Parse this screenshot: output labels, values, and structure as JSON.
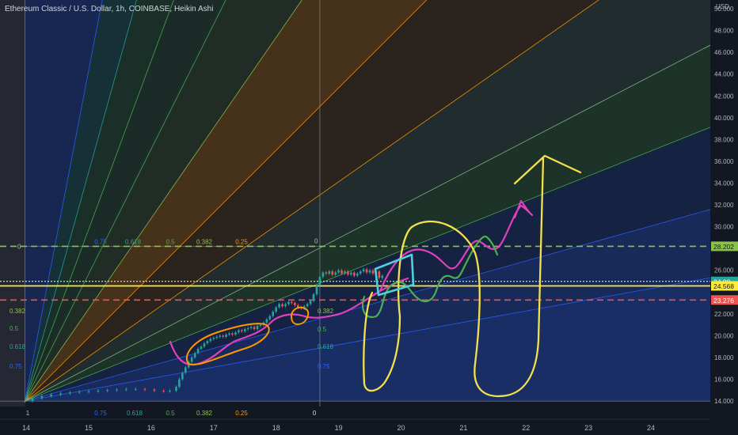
{
  "header": {
    "title": "Ethereum Classic / U.S. Dollar, 1h, COINBASE, Heikin Ashi"
  },
  "chart_data": {
    "type": "candlestick",
    "currency_label": "USD",
    "y_ticks": [
      14,
      16,
      18,
      20,
      22,
      24,
      26,
      28,
      30,
      32,
      34,
      36,
      38,
      40,
      42,
      44,
      46,
      48,
      50
    ],
    "y_tick_labels": [
      "14.000",
      "16.000",
      "18.000",
      "20.000",
      "22.000",
      "",
      "26.000",
      "",
      "30.000",
      "32.000",
      "34.000",
      "36.000",
      "38.000",
      "40.000",
      "42.000",
      "44.000",
      "46.000",
      "48.000",
      "50.000"
    ],
    "ylim": [
      13.5,
      50.8
    ],
    "x_labels": [
      {
        "day": 14,
        "label": "14"
      },
      {
        "day": 15,
        "label": "15"
      },
      {
        "day": 16,
        "label": "16"
      },
      {
        "day": 17,
        "label": "17"
      },
      {
        "day": 18,
        "label": "18"
      },
      {
        "day": 19,
        "label": "19"
      },
      {
        "day": 20,
        "label": "20"
      },
      {
        "day": 21,
        "label": "21"
      },
      {
        "day": 22,
        "label": "22"
      },
      {
        "day": 23,
        "label": "23"
      },
      {
        "day": 24,
        "label": "24"
      }
    ],
    "xlim": [
      13.58,
      24.95
    ],
    "price_lines": [
      {
        "value": 28.202,
        "label": "28.202",
        "color": "#8bc34a",
        "dashed": true
      },
      {
        "value": 24.568,
        "label": "24.568",
        "color": "#ffeb3b",
        "dashed": false
      },
      {
        "value": 23.276,
        "label": "23.276",
        "color": "#ef5350",
        "dashed": true
      }
    ],
    "last_price_tag": {
      "value": 24.98,
      "label": "24.98",
      "color": "#26a69a"
    },
    "fans": [
      {
        "origin": {
          "day": 13.98,
          "price": 14.0
        },
        "ratios": [
          0,
          0.25,
          0.382,
          0.5,
          0.618,
          0.75,
          1
        ],
        "x_ratio_labels": [
          "1",
          "0.75",
          "0.618",
          "0.5",
          "0.382",
          "0.25",
          "0"
        ],
        "y_ratio_labels": [
          "0.75",
          "0.618",
          "0.5",
          "0.382",
          "0.25"
        ],
        "upper_ratio_labels": [
          "0.75",
          "0.618",
          "0.5",
          "0.382",
          "0.25",
          "0"
        ],
        "zero_label": "0"
      },
      {
        "origin": {
          "day": 18.7,
          "price": 28.202
        },
        "x_ratio_labels": [
          "0.382",
          "0.5",
          "0.618",
          "0.75"
        ],
        "zero_label": "0"
      }
    ],
    "candles": [
      [
        13.98,
        14.0
      ],
      [
        14.1,
        14.25
      ],
      [
        14.25,
        14.45
      ],
      [
        14.4,
        14.6
      ],
      [
        14.55,
        14.7
      ],
      [
        14.7,
        14.8
      ],
      [
        14.85,
        14.85
      ],
      [
        15.0,
        14.9
      ],
      [
        15.15,
        14.95
      ],
      [
        15.3,
        15.0
      ],
      [
        15.45,
        15.05
      ],
      [
        15.6,
        15.1
      ],
      [
        15.75,
        15.1
      ],
      [
        15.9,
        15.05
      ],
      [
        16.05,
        14.95
      ],
      [
        16.2,
        14.9
      ],
      [
        16.3,
        14.95
      ],
      [
        16.4,
        15.3
      ],
      [
        16.45,
        16.0
      ],
      [
        16.5,
        16.6
      ],
      [
        16.55,
        17.1
      ],
      [
        16.6,
        17.6
      ],
      [
        16.65,
        18.0
      ],
      [
        16.7,
        18.4
      ],
      [
        16.75,
        18.8
      ],
      [
        16.8,
        19.0
      ],
      [
        16.85,
        19.3
      ],
      [
        16.9,
        19.5
      ],
      [
        16.95,
        19.7
      ],
      [
        17.0,
        19.8
      ],
      [
        17.05,
        19.9
      ],
      [
        17.1,
        20.0
      ],
      [
        17.15,
        19.9
      ],
      [
        17.2,
        20.1
      ],
      [
        17.25,
        20.2
      ],
      [
        17.3,
        20.1
      ],
      [
        17.35,
        20.3
      ],
      [
        17.4,
        20.5
      ],
      [
        17.45,
        20.4
      ],
      [
        17.5,
        20.6
      ],
      [
        17.55,
        20.7
      ],
      [
        17.6,
        20.8
      ],
      [
        17.65,
        20.6
      ],
      [
        17.7,
        20.9
      ],
      [
        17.75,
        21.0
      ],
      [
        17.8,
        21.2
      ],
      [
        17.85,
        21.5
      ],
      [
        17.9,
        21.8
      ],
      [
        17.95,
        22.2
      ],
      [
        18.0,
        22.6
      ],
      [
        18.05,
        22.9
      ],
      [
        18.1,
        22.7
      ],
      [
        18.15,
        22.9
      ],
      [
        18.2,
        23.1
      ],
      [
        18.25,
        23.0
      ],
      [
        18.3,
        22.8
      ],
      [
        18.35,
        22.6
      ],
      [
        18.4,
        22.5
      ],
      [
        18.45,
        22.7
      ],
      [
        18.5,
        22.9
      ],
      [
        18.55,
        23.2
      ],
      [
        18.6,
        23.8
      ],
      [
        18.65,
        24.6
      ],
      [
        18.7,
        25.4
      ],
      [
        18.75,
        25.8
      ],
      [
        18.8,
        25.7
      ],
      [
        18.85,
        25.9
      ],
      [
        18.9,
        25.6
      ],
      [
        18.95,
        25.8
      ],
      [
        19.0,
        26.0
      ],
      [
        19.05,
        25.7
      ],
      [
        19.1,
        25.9
      ],
      [
        19.15,
        25.6
      ],
      [
        19.2,
        25.8
      ],
      [
        19.25,
        25.5
      ],
      [
        19.3,
        25.7
      ],
      [
        19.35,
        25.9
      ],
      [
        19.4,
        26.1
      ],
      [
        19.45,
        25.8
      ],
      [
        19.5,
        26.0
      ],
      [
        19.55,
        25.7
      ],
      [
        19.6,
        25.9
      ],
      [
        19.65,
        25.3
      ],
      [
        19.7,
        25.5
      ]
    ]
  },
  "drawings": {
    "colors": {
      "yellow": "#f4e04d",
      "pink": "#e040b8",
      "green": "#4caf50",
      "orange": "#ff9800",
      "cyan": "#4dd0e1"
    }
  }
}
